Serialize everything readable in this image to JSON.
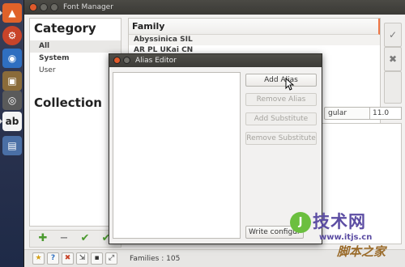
{
  "window": {
    "title": "Font Manager"
  },
  "category": {
    "title": "Category",
    "items": [
      {
        "label": "All"
      },
      {
        "label": "System"
      },
      {
        "label": "User"
      }
    ]
  },
  "collection": {
    "title": "Collection"
  },
  "family_list": {
    "header": "Family",
    "rows": [
      "Abyssinica SIL",
      "AR PL UKai CN"
    ]
  },
  "controls": {
    "style_value": "gular",
    "size_value": "11.0"
  },
  "status": {
    "families_label": "Families : 105"
  },
  "dialog": {
    "title": "Alias Editor",
    "buttons": {
      "add_alias": "Add Alias",
      "remove_alias": "Remove Alias",
      "add_substitute": "Add Substitute",
      "remove_substitute": "Remove Substitute",
      "write_config": "Write configur"
    }
  },
  "watermark": {
    "brand": "技术网",
    "url": "www.itjs.cn",
    "subtitle": "脚本之家",
    "logo_char": "J"
  },
  "colors": {
    "launcher": "#27304c",
    "titlebar": "#3c3b37",
    "close_button": "#e05a2b",
    "accent": "#f07746"
  }
}
